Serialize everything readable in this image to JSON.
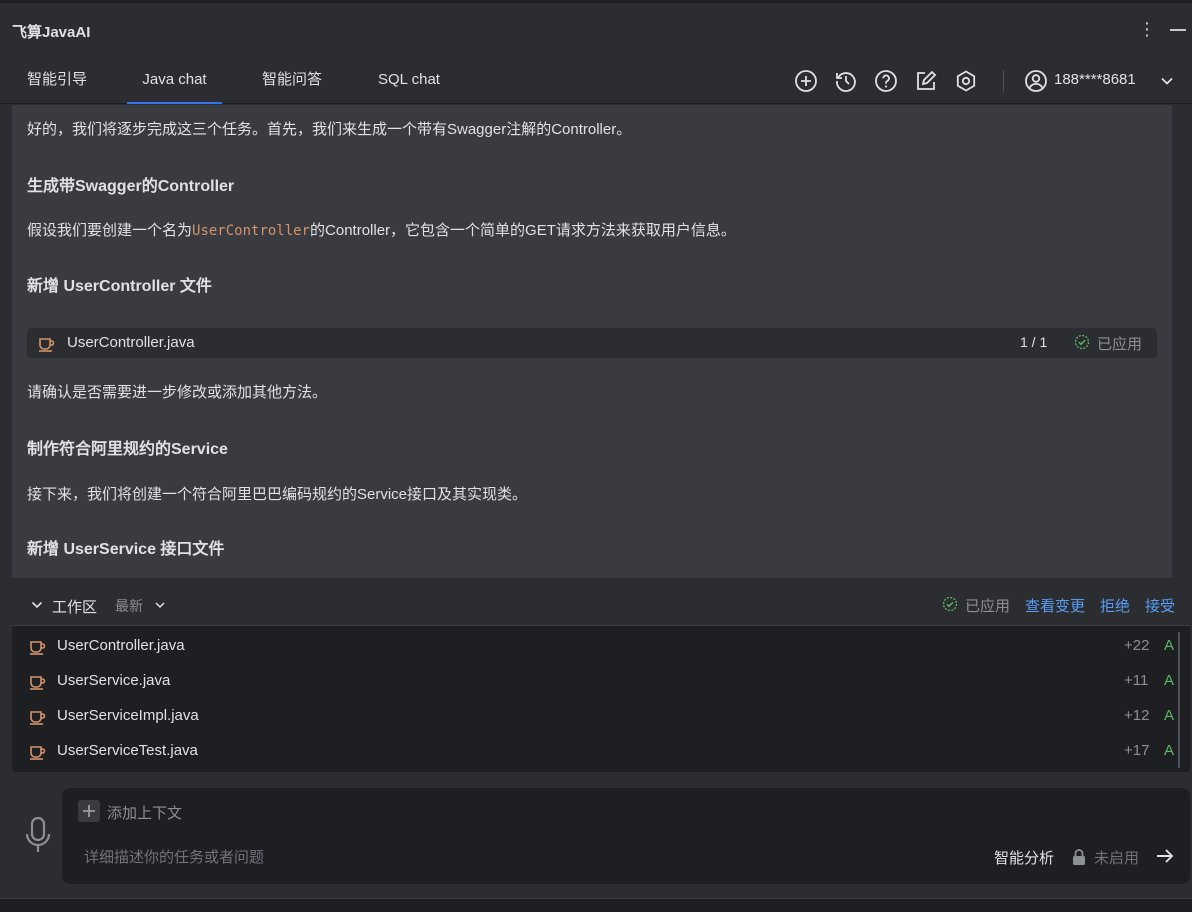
{
  "app": {
    "title": "飞算JavaAI"
  },
  "tabs": [
    {
      "label": "智能引导",
      "active": false
    },
    {
      "label": "Java chat",
      "active": true
    },
    {
      "label": "智能问答",
      "active": false
    },
    {
      "label": "SQL chat",
      "active": false
    }
  ],
  "toolbar_icons": [
    "plus-circle-icon",
    "history-icon",
    "help-icon",
    "edit-icon",
    "settings-icon"
  ],
  "user": {
    "name": "188****8681"
  },
  "chat": {
    "intro": "好的，我们将逐步完成这三个任务。首先，我们来生成一个带有Swagger注解的Controller。",
    "heading1": "生成带Swagger的Controller",
    "para1_pre": "假设我们要创建一个名为",
    "para1_code": "UserController",
    "para1_post": "的Controller，它包含一个简单的GET请求方法来获取用户信息。",
    "heading2": "新增 UserController 文件",
    "file_card": {
      "name": "UserController.java",
      "count": "1 / 1",
      "status": "已应用"
    },
    "confirm": "请确认是否需要进一步修改或添加其他方法。",
    "heading3": "制作符合阿里规约的Service",
    "para2": "接下来，我们将创建一个符合阿里巴巴编码规约的Service接口及其实现类。",
    "heading4": "新增 UserService 接口文件"
  },
  "workspace": {
    "title": "工作区",
    "filter": "最新",
    "applied": "已应用",
    "actions": {
      "view_changes": "查看变更",
      "reject": "拒绝",
      "accept": "接受"
    },
    "files": [
      {
        "name": "UserController.java",
        "diff": "+22",
        "status": "A"
      },
      {
        "name": "UserService.java",
        "diff": "+11",
        "status": "A"
      },
      {
        "name": "UserServiceImpl.java",
        "diff": "+12",
        "status": "A"
      },
      {
        "name": "UserServiceTest.java",
        "diff": "+17",
        "status": "A"
      }
    ]
  },
  "input": {
    "add_context": "添加上下文",
    "placeholder": "详细描述你的任务或者问题",
    "smart_analysis": "智能分析",
    "smart_status": "未启用"
  },
  "colors": {
    "accent": "#3574f0",
    "link": "#589df6",
    "java_icon": "#d5936a",
    "added": "#5fb865",
    "applied_check": "#5fb865"
  }
}
